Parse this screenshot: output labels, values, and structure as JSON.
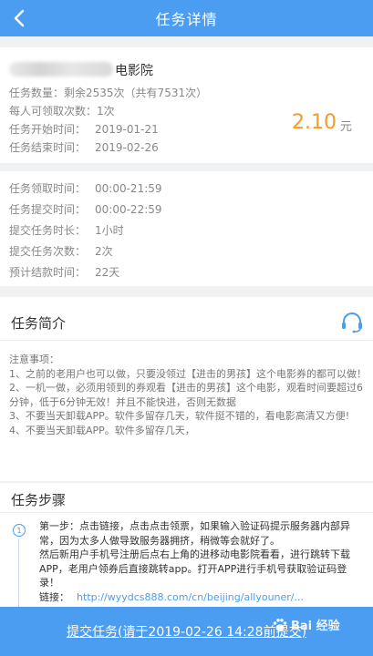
{
  "nav": {
    "title": "任务详情",
    "back_icon": "chevron-left-icon"
  },
  "task": {
    "cinema_suffix": "电影院",
    "quantity_label": "任务数量：",
    "quantity_value": "剩余2535次（共有7531次）",
    "per_user_label": "每人可领取次数：",
    "per_user_value": "1次",
    "start_label": "任务开始时间：",
    "start_value": "2019-01-21",
    "end_label": "任务结束时间：",
    "end_value": "2019-02-26",
    "price": "2.10",
    "price_unit": "元"
  },
  "times": {
    "claim_label": "任务领取时间：",
    "claim_value": "00:00-21:59",
    "submit_label": "任务提交时间：",
    "submit_value": "00:00-22:59",
    "duration_label": "提交任务时长：",
    "duration_value": "1小时",
    "count_label": "提交任务次数：",
    "count_value": "2次",
    "settle_label": "预计结款时间：",
    "settle_value": "22天"
  },
  "intro": {
    "title": "任务简介",
    "headset_icon": "headset-icon",
    "notes": [
      "注意事项：",
      "1、之前的老用户也可以做，只要没领过【进击的男孩】这个电影券的都可以做！",
      "2、一机一做，必须用领到的券观看【进击的男孩】这个电影，观看时间要超过6分钟，低于6分钟无效！并且不能快进，否则无数据",
      "3、不要当天卸载APP。软件多留存几天，软件挺不错的，看电影高清又方便!",
      "4、不要当天卸载APP。软件多留存几天，"
    ]
  },
  "steps": {
    "title": "任务步骤",
    "step_number": "1",
    "lines": [
      "第一步：点击链接，点击点击领票，如果输入验证码提示服务器内部异常，因为太多人做导致服务器拥挤，稍微等会就好了。",
      "然后新用户手机号注册后点右上角的进移动电影院看看，进行跳转下载APP，老用户领券后直接跳转app。打开APP进行手机号获取验证码登录！"
    ],
    "link_label": "链接：",
    "link_value": "http://wyydcs888.com/cn/beijing/allyouner/..."
  },
  "submit": {
    "label": "提交任务(请于2019-02-26 14:28前提交)"
  },
  "watermark": {
    "text": "Bai 经验"
  },
  "colors": {
    "primary": "#4a9df0",
    "price": "#f39a2b",
    "background": "#f0f1f3"
  }
}
